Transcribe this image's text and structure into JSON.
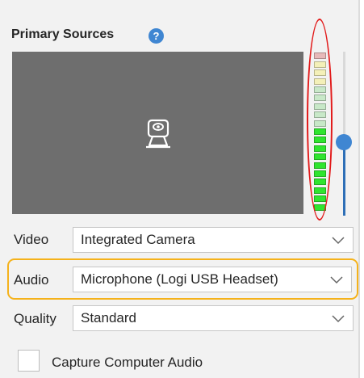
{
  "primary_sources": {
    "title": "Primary Sources",
    "help_icon": "help-icon",
    "help_glyph": "?"
  },
  "preview": {
    "icon": "webcam-icon"
  },
  "audio_meter": {
    "level": 0.55,
    "segment_count": 19,
    "colors": {
      "active": "#2fe52f",
      "inactive_green": "#c8e8c8",
      "inactive_yellow": "#f4f0b8",
      "inactive_red": "#e7b9b9"
    }
  },
  "volume_slider": {
    "level": 0.45,
    "accent": "#2e6fb7"
  },
  "video": {
    "label": "Video",
    "value": "Integrated Camera"
  },
  "audio": {
    "label": "Audio",
    "value": "Microphone (Logi USB Headset)"
  },
  "quality": {
    "label": "Quality",
    "value": "Standard"
  },
  "capture_audio": {
    "label": "Capture Computer Audio",
    "checked": false
  },
  "annotations": {
    "meter_highlight_color": "#e21b1b",
    "audio_highlight_color": "#f5b21b"
  }
}
